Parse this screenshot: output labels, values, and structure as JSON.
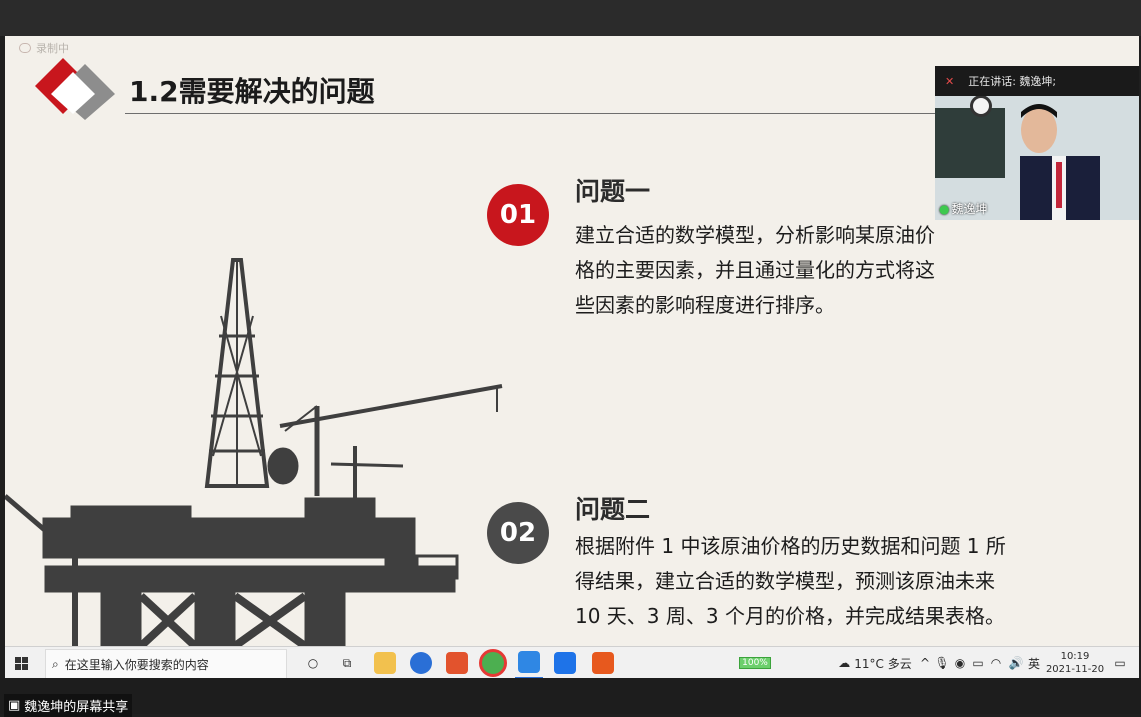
{
  "recording": {
    "label": "录制中"
  },
  "slide": {
    "title": "1.2需要解决的问题",
    "q1": {
      "number": "01",
      "heading": "问题一",
      "lines": [
        "建立合适的数学模型，分析影响某原油价",
        "格的主要因素，并且通过量化的方式将这",
        "些因素的影响程度进行排序。"
      ]
    },
    "q2": {
      "number": "02",
      "heading": "问题二",
      "lines": [
        "根据附件 1 中该原油价格的历史数据和问题 1 所",
        "得结果，建立合适的数学模型，预测该原油未来",
        "10 天、3 周、3 个月的价格，并完成结果表格。"
      ]
    }
  },
  "video": {
    "speaking_label": "正在讲话: 魏逸坤;",
    "participant_name": "魏逸坤"
  },
  "taskbar": {
    "search_placeholder": "在这里输入你要搜索的内容",
    "battery": "100%",
    "weather": "11°C 多云",
    "ime": "英",
    "time": "10:19",
    "date": "2021-11-20"
  },
  "share": {
    "label": "魏逸坤的屏幕共享"
  },
  "colors": {
    "accent_red": "#c8161d",
    "badge_gray": "#4a4a4a",
    "slide_bg": "#f3f0ea"
  }
}
